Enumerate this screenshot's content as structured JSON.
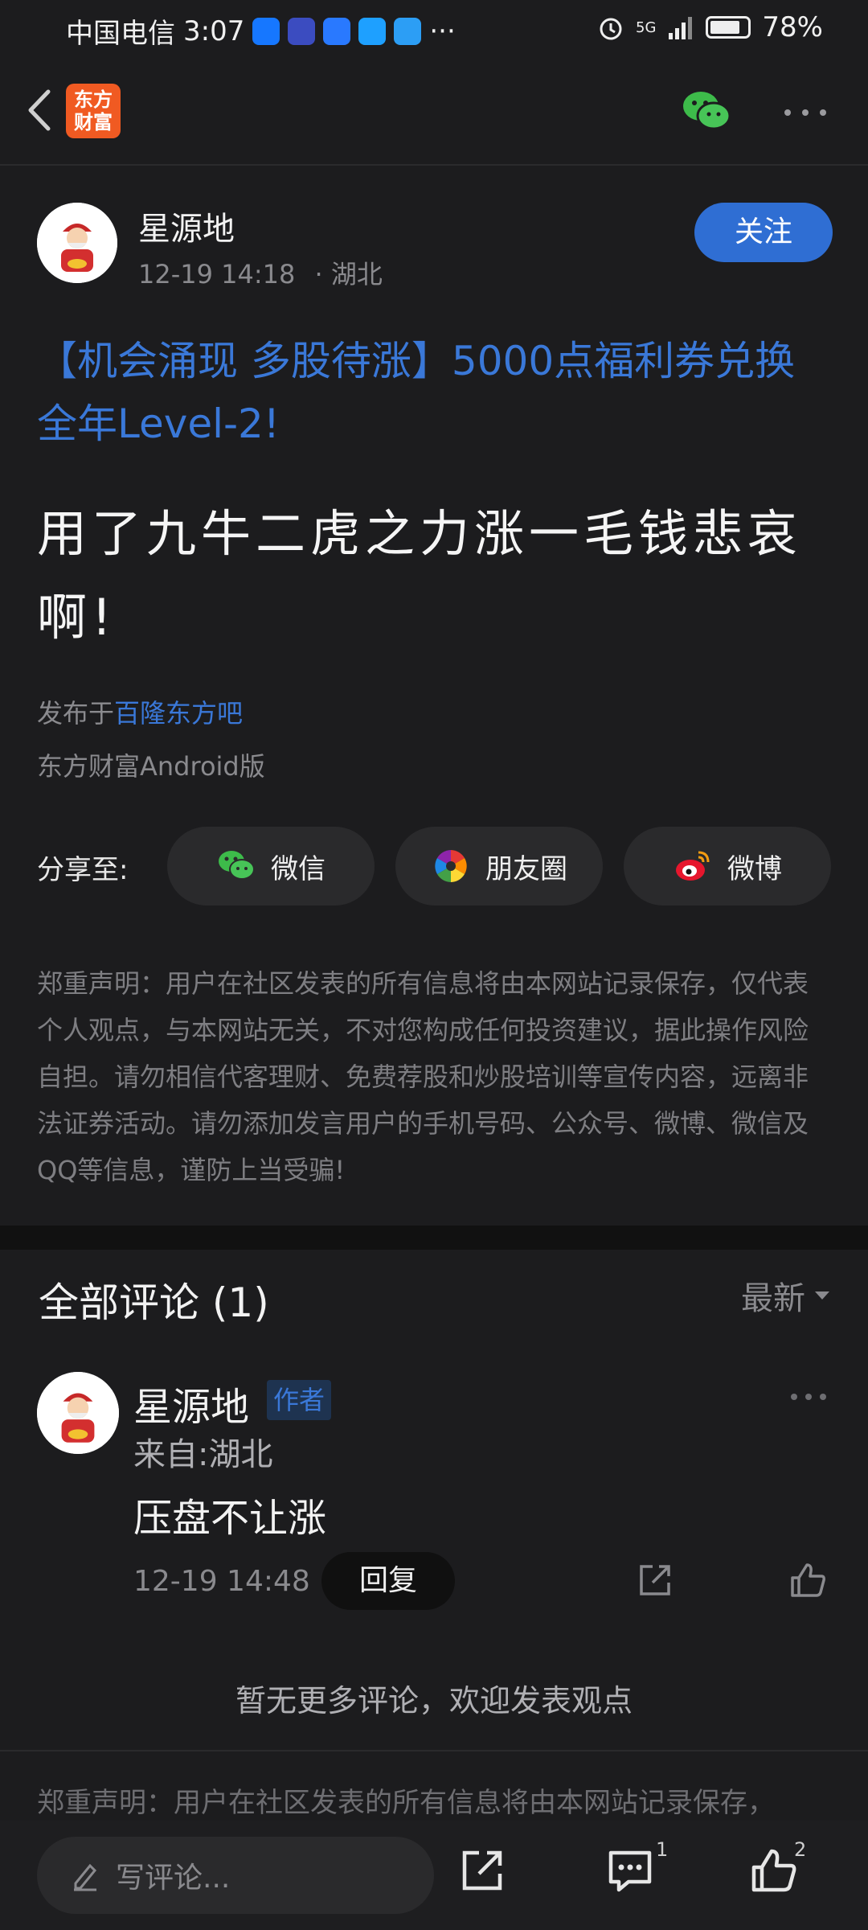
{
  "status": {
    "carrier": "中国电信",
    "time": "3:07",
    "more": "···",
    "network": "5G",
    "battery": "78%",
    "app_icon_colors": [
      "#1677ff",
      "#3b4cc0",
      "#2979ff",
      "#1ea0ff",
      "#2c9ef5"
    ]
  },
  "topbar": {
    "logo_text_1": "东方",
    "logo_text_2": "财富",
    "brand_color": "#f05a22"
  },
  "post": {
    "author": "星源地",
    "time": "12-19 14:18",
    "location": "· 湖北",
    "follow_label": "关注",
    "promo": "【机会涌现 多股待涨】5000点福利券兑换全年Level-2!",
    "title": "用了九牛二虎之力涨一毛钱悲哀啊!",
    "published_prefix": "发布于",
    "published_forum": "百隆东方吧",
    "client": "东方财富Android版"
  },
  "share": {
    "label": "分享至:",
    "wechat": "微信",
    "moments": "朋友圈",
    "weibo": "微博"
  },
  "disclaimer": "郑重声明：用户在社区发表的所有信息将由本网站记录保存，仅代表个人观点，与本网站无关，不对您构成任何投资建议，据此操作风险自担。请勿相信代客理财、免费荐股和炒股培训等宣传内容，远离非法证券活动。请勿添加发言用户的手机号码、公众号、微博、微信及QQ等信息，谨防上当受骗!",
  "comments": {
    "header": "全部评论 (1)",
    "sort_label": "最新",
    "items": [
      {
        "author": "星源地",
        "badge": "作者",
        "from": "来自:湖北",
        "text": "压盘不让涨",
        "time": "12-19 14:48",
        "reply_label": "回复"
      }
    ],
    "no_more": "暂无更多评论，欢迎发表观点"
  },
  "footer_disclaimer": "郑重声明：用户在社区发表的所有信息将由本网站记录保存，",
  "bottombar": {
    "comment_placeholder": "写评论...",
    "comment_count": "1",
    "like_count": "2"
  }
}
